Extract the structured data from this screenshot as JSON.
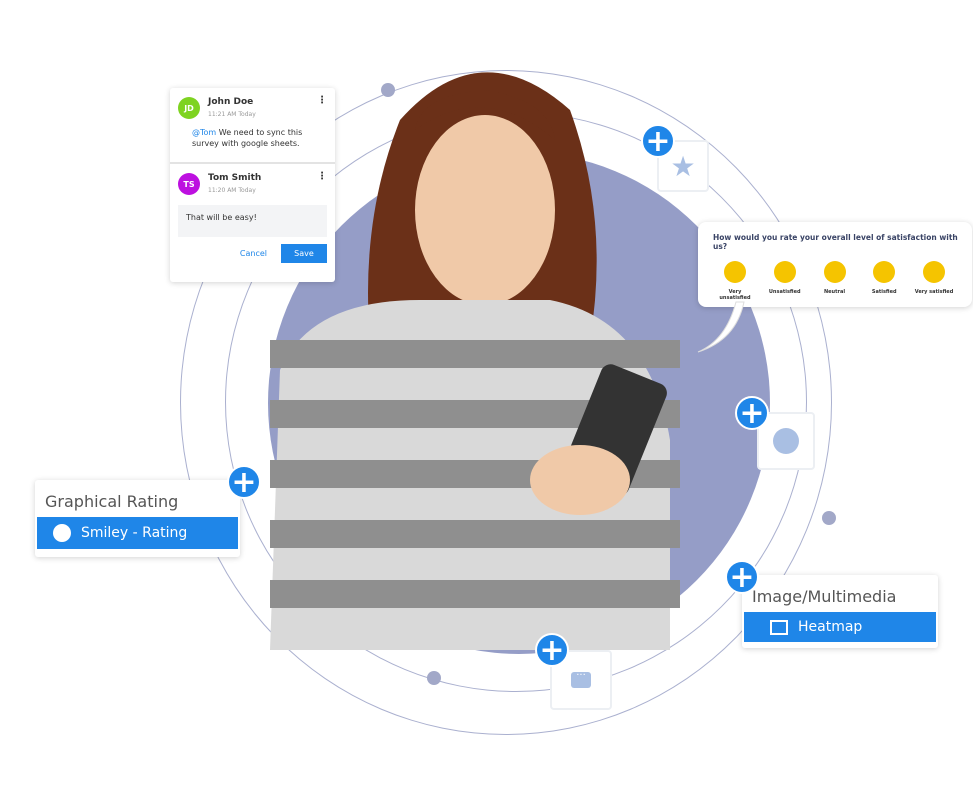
{
  "comments": [
    {
      "initials": "JD",
      "name": "John Doe",
      "time": "11:21 AM Today",
      "mention": "@Tom",
      "text": " We need to sync this survey with google sheets.",
      "color": "#7ed321"
    },
    {
      "initials": "TS",
      "name": "Tom Smith",
      "time": "11:20 AM Today",
      "reply": "That will be easy!",
      "color": "#bd10e0"
    }
  ],
  "comment_actions": {
    "cancel": "Cancel",
    "save": "Save"
  },
  "survey": {
    "question": "How would you rate your overall level of satisfaction with us?",
    "options": [
      "Very unsatisfied",
      "Unsatisfied",
      "Neutral",
      "Satisfied",
      "Very satisfied"
    ]
  },
  "graphical_rating": {
    "title": "Graphical Rating",
    "item": "Smiley - Rating",
    "icon": "smiley-icon"
  },
  "multimedia": {
    "title": "Image/Multimedia",
    "item": "Heatmap",
    "icon": "image-icon"
  },
  "tiles": [
    "star-icon",
    "smiley-icon",
    "chat-icon"
  ],
  "colors": {
    "accent": "#1f86e8",
    "circle": "#959dc7",
    "ring": "#aab0cf"
  }
}
